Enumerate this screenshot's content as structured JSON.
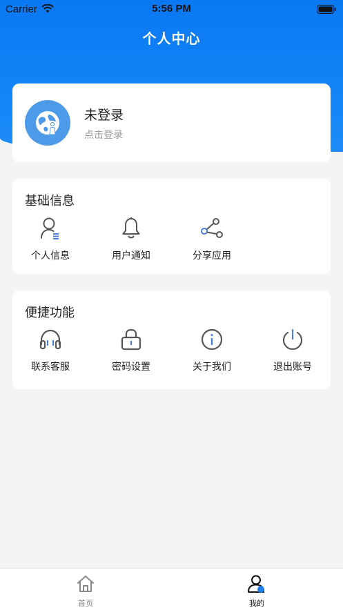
{
  "status_bar": {
    "carrier": "Carrier",
    "time": "5:56 PM"
  },
  "header": {
    "title": "个人中心"
  },
  "profile": {
    "title": "未登录",
    "subtitle": "点击登录"
  },
  "basic_info": {
    "title": "基础信息",
    "items": [
      {
        "label": "个人信息",
        "icon": "user-info-icon"
      },
      {
        "label": "用户通知",
        "icon": "bell-icon"
      },
      {
        "label": "分享应用",
        "icon": "share-icon"
      }
    ]
  },
  "shortcuts": {
    "title": "便捷功能",
    "items": [
      {
        "label": "联系客服",
        "icon": "headphones-icon"
      },
      {
        "label": "密码设置",
        "icon": "lock-icon"
      },
      {
        "label": "关于我们",
        "icon": "info-icon"
      },
      {
        "label": "退出账号",
        "icon": "power-icon"
      }
    ]
  },
  "tabbar": {
    "items": [
      {
        "label": "首页",
        "icon": "home-icon",
        "active": false
      },
      {
        "label": "我的",
        "icon": "user-icon",
        "active": true
      }
    ]
  },
  "colors": {
    "primary": "#0a78f2",
    "accent_blue": "#4d7ee6",
    "background": "#f4f4f4"
  }
}
